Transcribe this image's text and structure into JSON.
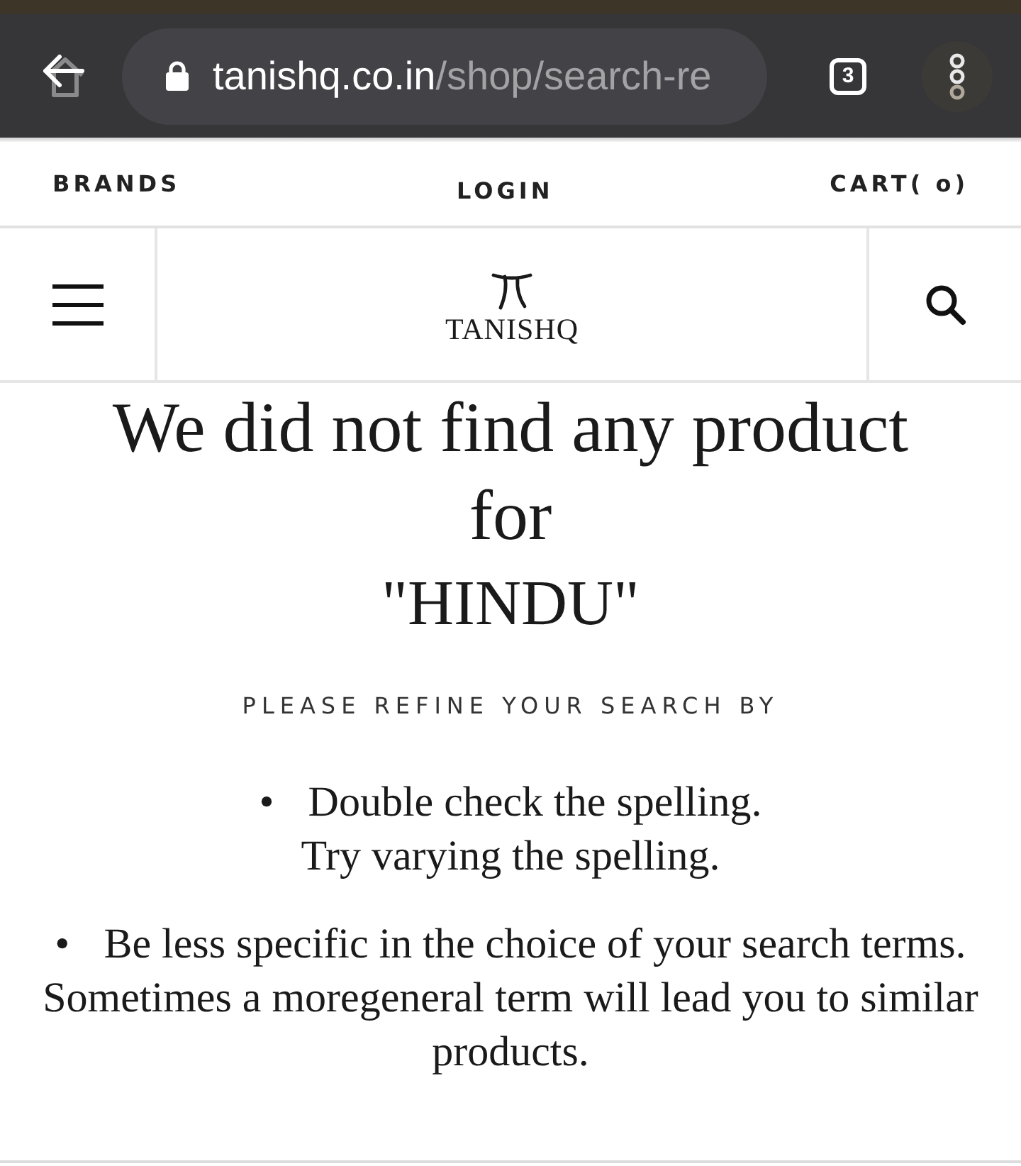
{
  "browser": {
    "url_domain": "tanishq.co.in",
    "url_path": "/shop/search-re",
    "tab_count": "3"
  },
  "top_nav": [
    {
      "label": "BRANDS"
    },
    {
      "label": "LOGIN"
    },
    {
      "label": "CART( o)"
    }
  ],
  "header": {
    "logo_text": "TANISHQ"
  },
  "message": {
    "heading_lines": [
      "We did not find any product",
      "for"
    ],
    "query": "\"HINDU\""
  },
  "refine_label": "PLEASE REFINE YOUR SEARCH BY",
  "tips": [
    {
      "bullet": "•",
      "lines": [
        "Double check the spelling.",
        "Try varying the spelling."
      ]
    },
    {
      "bullet": "•",
      "lines": [
        "Be less specific in the choice of your search terms.",
        "Sometimes a moregeneral term will lead you to similar",
        "products."
      ]
    }
  ]
}
